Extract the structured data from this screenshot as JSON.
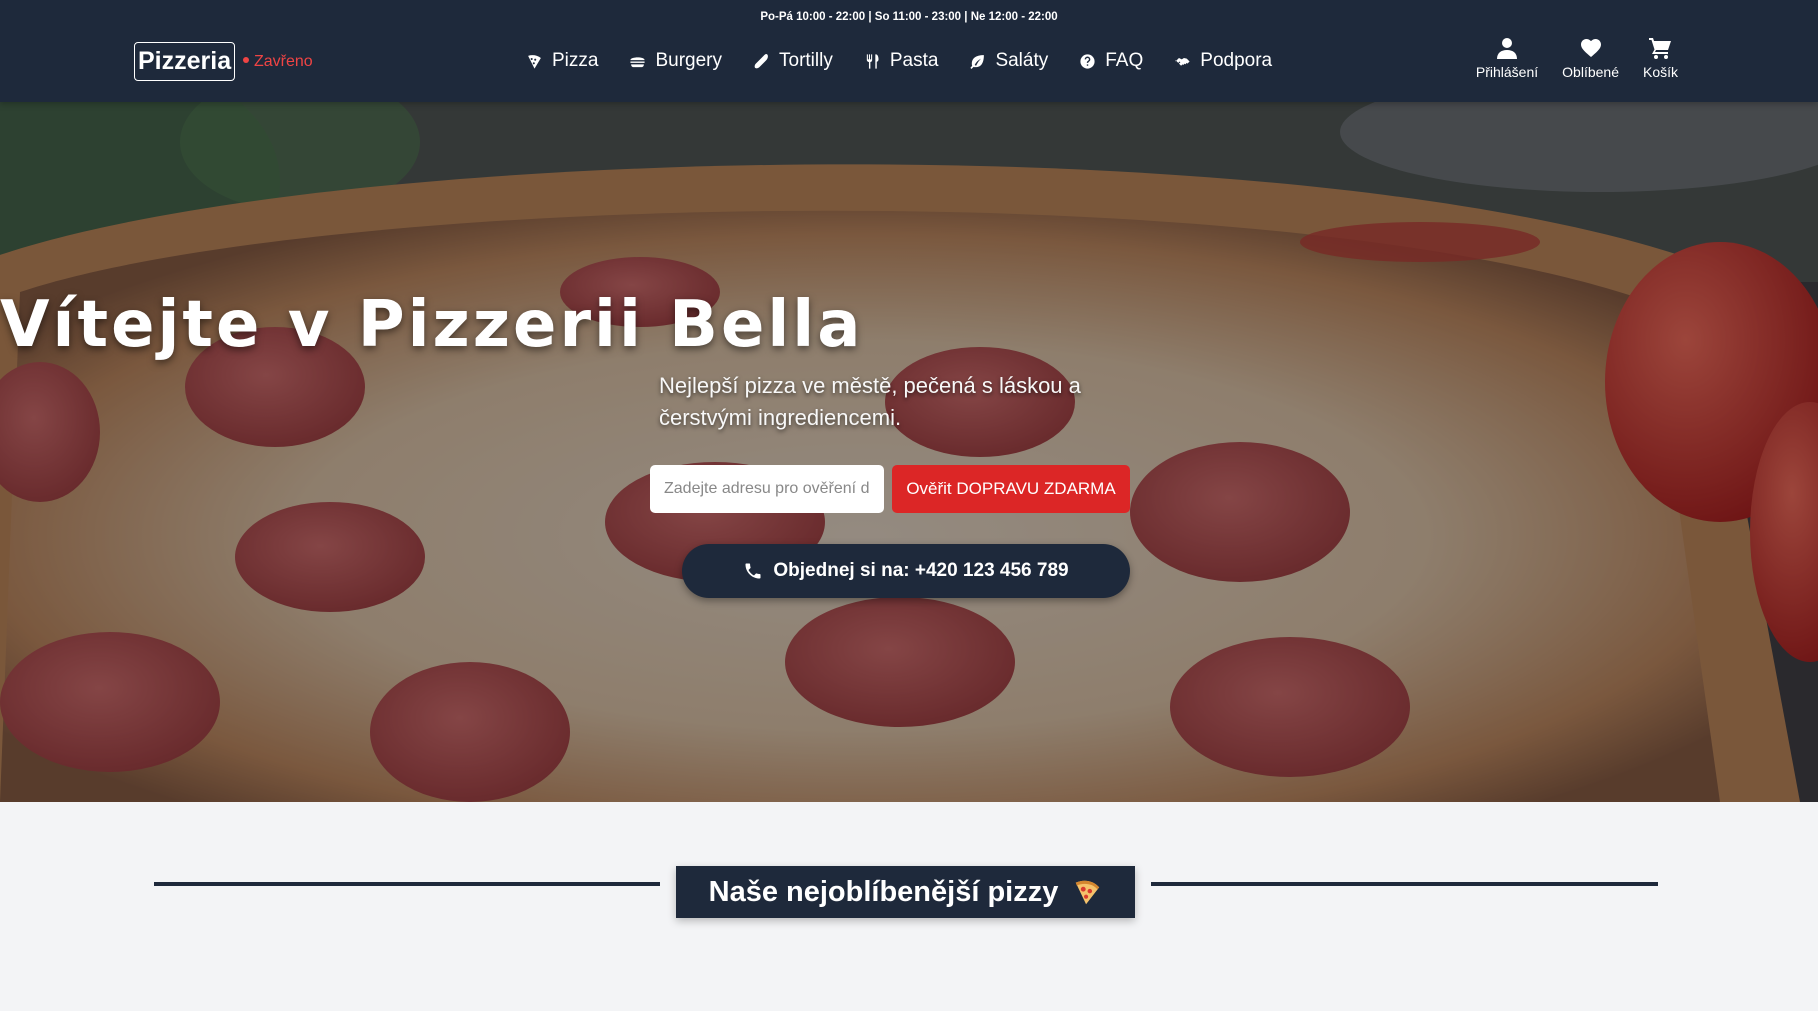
{
  "header": {
    "hours": "Po-Pá 10:00 - 22:00 | So 11:00 - 23:00 | Ne 12:00 - 22:00",
    "logo": "Pizzeria",
    "status": "Zavřeno",
    "status_color": "#ef4444",
    "nav": [
      {
        "label": "Pizza",
        "icon": "pizza-slice-icon"
      },
      {
        "label": "Burgery",
        "icon": "burger-icon"
      },
      {
        "label": "Tortilly",
        "icon": "tortilla-icon"
      },
      {
        "label": "Pasta",
        "icon": "utensils-icon"
      },
      {
        "label": "Saláty",
        "icon": "leaf-icon"
      },
      {
        "label": "FAQ",
        "icon": "question-circle-icon"
      },
      {
        "label": "Podpora",
        "icon": "handshake-icon"
      }
    ],
    "actions": {
      "login": "Přihlášení",
      "favorites": "Oblíbené",
      "cart": "Košík"
    }
  },
  "hero": {
    "title": "Vítejte v Pizzerii Bella",
    "subtitle": "Nejlepší pizza ve městě, pečená s láskou a čerstvými ingrediencemi.",
    "address_placeholder": "Zadejte adresu pro ověření dopravy",
    "verify_button": "Ověřit DOPRAVU ZDARMA",
    "call_button": "Objednej si na: +420 123 456 789"
  },
  "section": {
    "title": "Naše nejoblíbenější pizzy"
  },
  "colors": {
    "navy": "#1e293b",
    "accent_red": "#dc2626",
    "background": "#f3f4f6"
  }
}
